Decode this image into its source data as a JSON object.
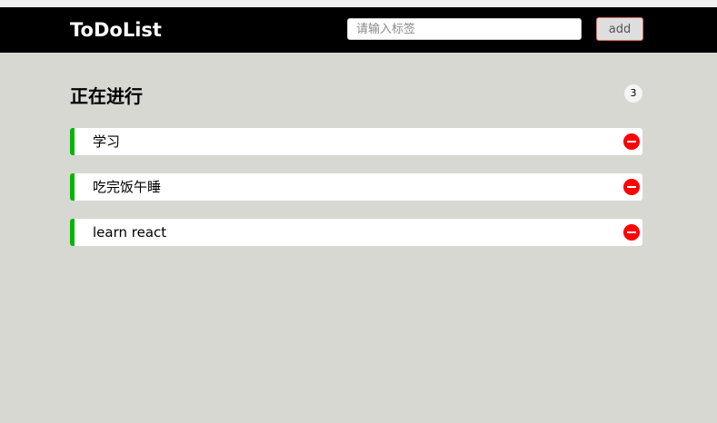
{
  "header": {
    "title": "ToDoList",
    "input_placeholder": "请输入标签",
    "input_value": "",
    "add_label": "add"
  },
  "section": {
    "title": "正在进行",
    "count": "3"
  },
  "todos": [
    {
      "text": "学习"
    },
    {
      "text": "吃完饭午睡"
    },
    {
      "text": "learn react"
    }
  ],
  "icons": {
    "delete": "remove-circle-icon"
  },
  "colors": {
    "background": "#d7d8d2",
    "header": "#000000",
    "item_accent": "#00b800",
    "delete": "#ff0000",
    "add_border": "#e06a5b"
  }
}
